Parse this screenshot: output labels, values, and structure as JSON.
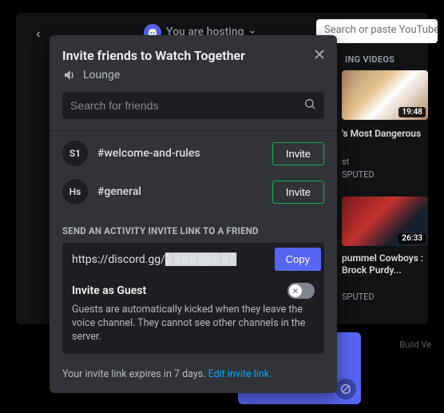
{
  "background": {
    "hosting_text": "You are hosting",
    "search_placeholder": "Search or paste YouTube URL",
    "section_title": "ING VIDEOS",
    "video1": {
      "title": "'s Most Dangerous",
      "sub": "st",
      "sub2": "SPUTED",
      "duration": "19:48"
    },
    "video2": {
      "title": "pummel Cowboys : Brock Purdy...",
      "sub": "SPUTED",
      "duration": "26:33"
    },
    "build": "Build Ve"
  },
  "modal": {
    "title": "Invite friends to Watch Together",
    "channel": "Lounge",
    "search_placeholder": "Search for friends",
    "rows": [
      {
        "avatar": "S1",
        "name": "#welcome-and-rules",
        "button": "Invite"
      },
      {
        "avatar": "Hs",
        "name": "#general",
        "button": "Invite"
      }
    ],
    "section_label": "SEND AN ACTIVITY INVITE LINK TO A FRIEND",
    "link": "https://discord.gg/█████████",
    "copy": "Copy",
    "guest_title": "Invite as Guest",
    "guest_desc": "Guests are automatically kicked when they leave the voice channel. They cannot see other channels in the server.",
    "footer_text": "Your invite link expires in 7 days. ",
    "footer_link": "Edit invite link."
  }
}
